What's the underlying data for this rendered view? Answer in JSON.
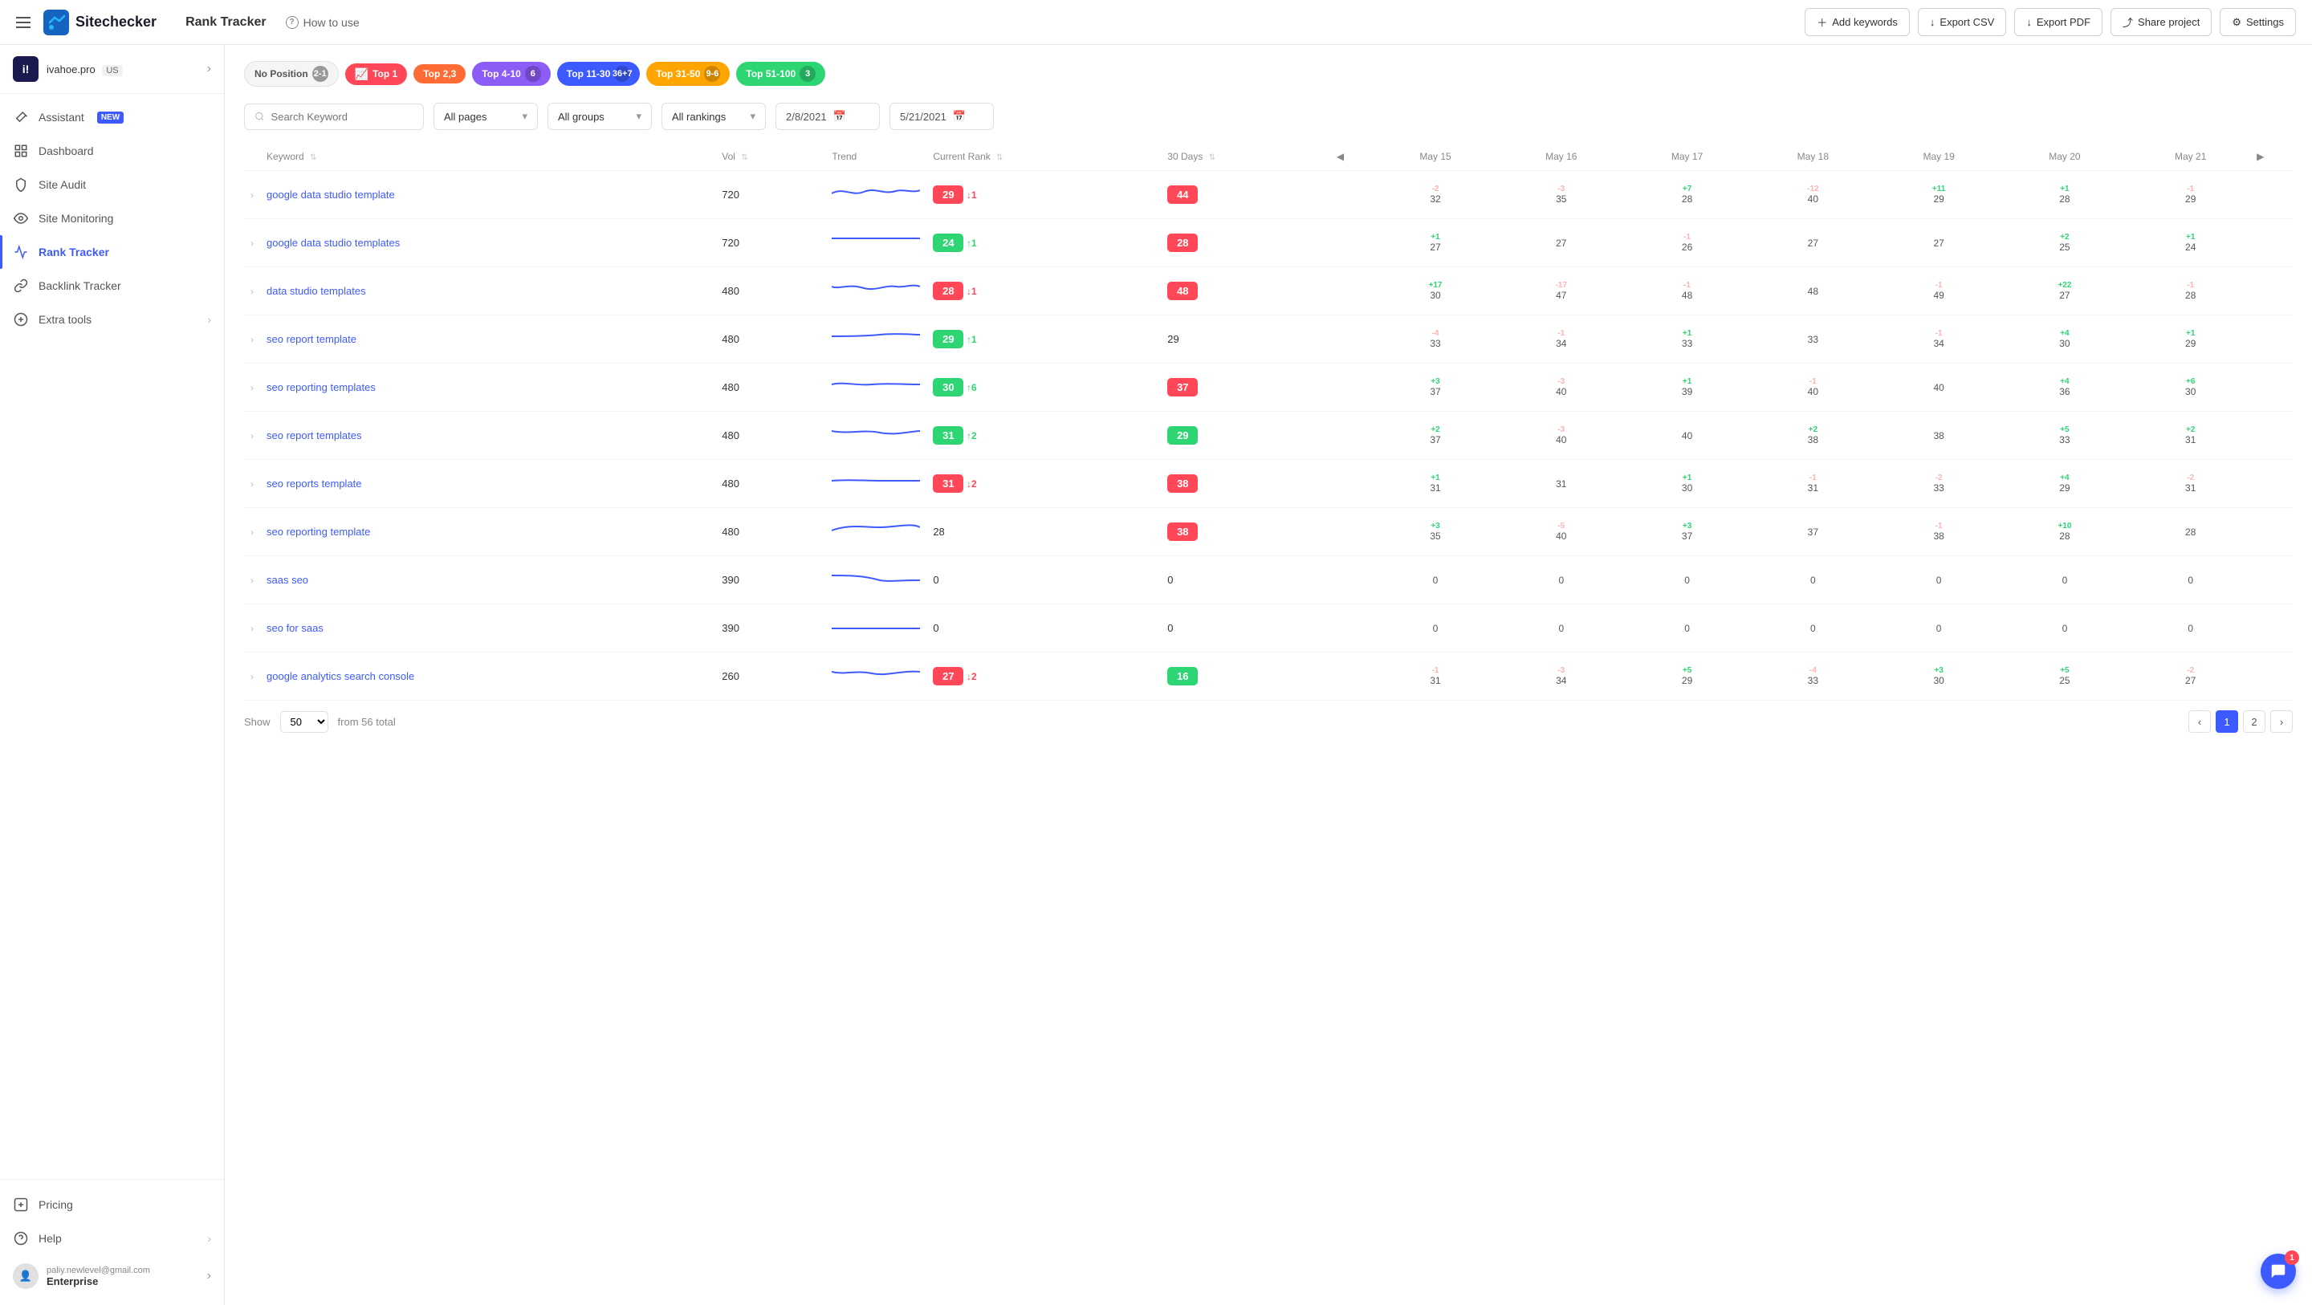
{
  "topNav": {
    "appName": "Sitechecker",
    "pageTitle": "Rank Tracker",
    "howToUse": "How to use",
    "buttons": [
      {
        "label": "Add keywords",
        "name": "add-keywords-button"
      },
      {
        "label": "Export CSV",
        "name": "export-csv-button"
      },
      {
        "label": "Export PDF",
        "name": "export-pdf-button"
      },
      {
        "label": "Share project",
        "name": "share-project-button"
      },
      {
        "label": "Settings",
        "name": "settings-button"
      }
    ]
  },
  "sidebar": {
    "site": {
      "name": "ivahoe.pro",
      "badge": "US"
    },
    "navItems": [
      {
        "label": "Assistant",
        "badge": "NEW",
        "name": "assistant",
        "icon": "wand"
      },
      {
        "label": "Dashboard",
        "name": "dashboard",
        "icon": "grid"
      },
      {
        "label": "Site Audit",
        "name": "site-audit",
        "icon": "shield"
      },
      {
        "label": "Site Monitoring",
        "name": "site-monitoring",
        "icon": "eye"
      },
      {
        "label": "Rank Tracker",
        "name": "rank-tracker",
        "icon": "chart",
        "active": true
      },
      {
        "label": "Backlink Tracker",
        "name": "backlink-tracker",
        "icon": "link"
      },
      {
        "label": "Extra tools",
        "name": "extra-tools",
        "icon": "plus"
      }
    ],
    "bottomItems": [
      {
        "label": "Pricing",
        "name": "pricing",
        "icon": "tag"
      },
      {
        "label": "Help",
        "name": "help",
        "icon": "question"
      }
    ],
    "user": {
      "email": "paliy.newlevel@gmail.com",
      "plan": "Enterprise"
    }
  },
  "badges": [
    {
      "label": "No Position",
      "count": "2-1",
      "style": "nopos"
    },
    {
      "label": "Top 1",
      "count": "",
      "style": "top1"
    },
    {
      "label": "Top 2,3",
      "count": "",
      "style": "top23"
    },
    {
      "label": "Top 4-10",
      "count": "6",
      "style": "top410"
    },
    {
      "label": "Top 11-30",
      "count": "36+7",
      "style": "top1130"
    },
    {
      "label": "Top 31-50",
      "count": "9-6",
      "style": "top3150"
    },
    {
      "label": "Top 51-100",
      "count": "3",
      "style": "top51100"
    }
  ],
  "filters": {
    "searchPlaceholder": "Search Keyword",
    "pages": "All pages",
    "groups": "All groups",
    "rankings": "All rankings",
    "dateFrom": "2/8/2021",
    "dateTo": "5/21/2021"
  },
  "tableHeaders": {
    "keyword": "Keyword",
    "vol": "Vol",
    "trend": "Trend",
    "currentRank": "Current Rank",
    "thirtyDays": "30 Days",
    "dates": [
      "May 15",
      "May 16",
      "May 17",
      "May 18",
      "May 19",
      "May 20",
      "May 21"
    ]
  },
  "rows": [
    {
      "keyword": "google data studio template",
      "vol": "720",
      "currentRank": "29",
      "currentRankStyle": "red",
      "change": "1",
      "changeDir": "down",
      "thirtyDays": "44",
      "thirtyDaysStyle": "red",
      "dates": [
        {
          "delta": "-2",
          "val": "32"
        },
        {
          "delta": "-3",
          "val": "35"
        },
        {
          "delta": "+7",
          "val": "28"
        },
        {
          "delta": "-12",
          "val": "40"
        },
        {
          "delta": "+11",
          "val": "29"
        },
        {
          "delta": "+1",
          "val": "28"
        },
        {
          "delta": "-1",
          "val": "29"
        }
      ]
    },
    {
      "keyword": "google data studio templates",
      "vol": "720",
      "currentRank": "24",
      "currentRankStyle": "green",
      "change": "1",
      "changeDir": "up",
      "thirtyDays": "28",
      "thirtyDaysStyle": "red",
      "dates": [
        {
          "delta": "+1",
          "val": "27"
        },
        {
          "delta": "",
          "val": "27"
        },
        {
          "delta": "-1",
          "val": "26"
        },
        {
          "delta": "",
          "val": "27"
        },
        {
          "delta": "",
          "val": "27"
        },
        {
          "delta": "+2",
          "val": "25"
        },
        {
          "delta": "+1",
          "val": "24"
        }
      ]
    },
    {
      "keyword": "data studio templates",
      "vol": "480",
      "currentRank": "28",
      "currentRankStyle": "red",
      "change": "1",
      "changeDir": "down",
      "thirtyDays": "48",
      "thirtyDaysStyle": "red",
      "dates": [
        {
          "delta": "+17",
          "val": "30"
        },
        {
          "delta": "-17",
          "val": "47"
        },
        {
          "delta": "-1",
          "val": "48"
        },
        {
          "delta": "",
          "val": "48"
        },
        {
          "delta": "-1",
          "val": "49"
        },
        {
          "delta": "+22",
          "val": "27"
        },
        {
          "delta": "-1",
          "val": "28"
        }
      ]
    },
    {
      "keyword": "seo report template",
      "vol": "480",
      "currentRank": "29",
      "currentRankStyle": "green",
      "change": "1",
      "changeDir": "up",
      "thirtyDays": "29",
      "thirtyDaysStyle": "none",
      "dates": [
        {
          "delta": "-4",
          "val": "33"
        },
        {
          "delta": "-1",
          "val": "34"
        },
        {
          "delta": "+1",
          "val": "33"
        },
        {
          "delta": "",
          "val": "33"
        },
        {
          "delta": "-1",
          "val": "34"
        },
        {
          "delta": "+4",
          "val": "30"
        },
        {
          "delta": "+1",
          "val": "29"
        }
      ]
    },
    {
      "keyword": "seo reporting templates",
      "vol": "480",
      "currentRank": "30",
      "currentRankStyle": "green",
      "change": "6",
      "changeDir": "up",
      "thirtyDays": "37",
      "thirtyDaysStyle": "red",
      "dates": [
        {
          "delta": "+3",
          "val": "37"
        },
        {
          "delta": "-3",
          "val": "40"
        },
        {
          "delta": "+1",
          "val": "39"
        },
        {
          "delta": "-1",
          "val": "40"
        },
        {
          "delta": "",
          "val": "40"
        },
        {
          "delta": "+4",
          "val": "36"
        },
        {
          "delta": "+6",
          "val": "30"
        }
      ]
    },
    {
      "keyword": "seo report templates",
      "vol": "480",
      "currentRank": "31",
      "currentRankStyle": "green",
      "change": "2",
      "changeDir": "up",
      "thirtyDays": "29",
      "thirtyDaysStyle": "green",
      "dates": [
        {
          "delta": "+2",
          "val": "37"
        },
        {
          "delta": "-3",
          "val": "40"
        },
        {
          "delta": "",
          "val": "40"
        },
        {
          "delta": "+2",
          "val": "38"
        },
        {
          "delta": "",
          "val": "38"
        },
        {
          "delta": "+5",
          "val": "33"
        },
        {
          "delta": "+2",
          "val": "31"
        }
      ]
    },
    {
      "keyword": "seo reports template",
      "vol": "480",
      "currentRank": "31",
      "currentRankStyle": "red",
      "change": "2",
      "changeDir": "down",
      "thirtyDays": "38",
      "thirtyDaysStyle": "red",
      "dates": [
        {
          "delta": "+1",
          "val": "31"
        },
        {
          "delta": "",
          "val": "31"
        },
        {
          "delta": "+1",
          "val": "30"
        },
        {
          "delta": "-1",
          "val": "31"
        },
        {
          "delta": "-2",
          "val": "33"
        },
        {
          "delta": "+4",
          "val": "29"
        },
        {
          "delta": "-2",
          "val": "31"
        }
      ]
    },
    {
      "keyword": "seo reporting template",
      "vol": "480",
      "currentRank": "28",
      "currentRankStyle": "none",
      "change": "",
      "changeDir": "",
      "thirtyDays": "38",
      "thirtyDaysStyle": "red",
      "dates": [
        {
          "delta": "+3",
          "val": "35"
        },
        {
          "delta": "-5",
          "val": "40"
        },
        {
          "delta": "+3",
          "val": "37"
        },
        {
          "delta": "",
          "val": "37"
        },
        {
          "delta": "-1",
          "val": "38"
        },
        {
          "delta": "+10",
          "val": "28"
        },
        {
          "delta": "",
          "val": "28"
        }
      ]
    },
    {
      "keyword": "saas seo",
      "vol": "390",
      "currentRank": "0",
      "currentRankStyle": "none",
      "change": "",
      "changeDir": "",
      "thirtyDays": "0",
      "thirtyDaysStyle": "none",
      "dates": [
        {
          "delta": "",
          "val": "0"
        },
        {
          "delta": "",
          "val": "0"
        },
        {
          "delta": "",
          "val": "0"
        },
        {
          "delta": "",
          "val": "0"
        },
        {
          "delta": "",
          "val": "0"
        },
        {
          "delta": "",
          "val": "0"
        },
        {
          "delta": "",
          "val": "0"
        }
      ]
    },
    {
      "keyword": "seo for saas",
      "vol": "390",
      "currentRank": "0",
      "currentRankStyle": "none",
      "change": "",
      "changeDir": "",
      "thirtyDays": "0",
      "thirtyDaysStyle": "none",
      "dates": [
        {
          "delta": "",
          "val": "0"
        },
        {
          "delta": "",
          "val": "0"
        },
        {
          "delta": "",
          "val": "0"
        },
        {
          "delta": "",
          "val": "0"
        },
        {
          "delta": "",
          "val": "0"
        },
        {
          "delta": "",
          "val": "0"
        },
        {
          "delta": "",
          "val": "0"
        }
      ]
    },
    {
      "keyword": "google analytics search console",
      "vol": "260",
      "currentRank": "27",
      "currentRankStyle": "red",
      "change": "2",
      "changeDir": "down",
      "thirtyDays": "16",
      "thirtyDaysStyle": "green",
      "dates": [
        {
          "delta": "-1",
          "val": "31"
        },
        {
          "delta": "-3",
          "val": "34"
        },
        {
          "delta": "+5",
          "val": "29"
        },
        {
          "delta": "-4",
          "val": "33"
        },
        {
          "delta": "+3",
          "val": "30"
        },
        {
          "delta": "+5",
          "val": "25"
        },
        {
          "delta": "-2",
          "val": "27"
        }
      ]
    }
  ],
  "footer": {
    "showLabel": "Show",
    "showValue": "50",
    "fromTotal": "from 56 total",
    "currentPage": "1",
    "totalPages": "2"
  },
  "chat": {
    "notifCount": "1"
  }
}
